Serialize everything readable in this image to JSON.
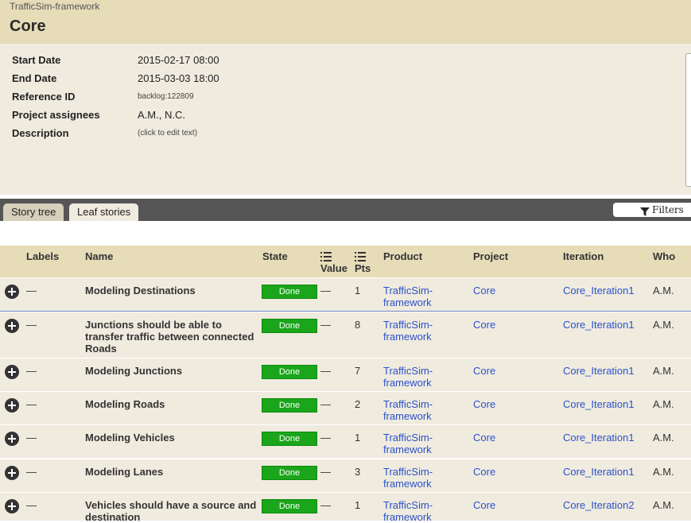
{
  "header": {
    "breadcrumb": "TrafficSim-framework",
    "title": "Core"
  },
  "info": {
    "start_date_label": "Start Date",
    "start_date": "2015-02-17 08:00",
    "end_date_label": "End Date",
    "end_date": "2015-03-03 18:00",
    "reference_label": "Reference ID",
    "reference": "backlog:122809",
    "assignees_label": "Project assignees",
    "assignees": "A.M., N.C.",
    "description_label": "Description",
    "description": "(click to edit text)"
  },
  "tabs": {
    "story_tree": "Story tree",
    "leaf_stories": "Leaf stories",
    "filters": "Filters"
  },
  "table": {
    "headers": {
      "labels": "Labels",
      "name": "Name",
      "state": "State",
      "value": "Value",
      "pts": "Pts",
      "product": "Product",
      "project": "Project",
      "iteration": "Iteration",
      "who": "Who"
    },
    "rows": [
      {
        "labels": "—",
        "name": "Modeling Destinations",
        "state": "Done",
        "value": "—",
        "pts": "1",
        "product": "TrafficSim-framework",
        "project": "Core",
        "iteration": "Core_Iteration1",
        "who": "A.M."
      },
      {
        "labels": "—",
        "name": "Junctions should be able to transfer traffic between connected Roads",
        "state": "Done",
        "value": "—",
        "pts": "8",
        "product": "TrafficSim-framework",
        "project": "Core",
        "iteration": "Core_Iteration1",
        "who": "A.M."
      },
      {
        "labels": "—",
        "name": "Modeling Junctions",
        "state": "Done",
        "value": "—",
        "pts": "7",
        "product": "TrafficSim-framework",
        "project": "Core",
        "iteration": "Core_Iteration1",
        "who": "A.M."
      },
      {
        "labels": "—",
        "name": "Modeling Roads",
        "state": "Done",
        "value": "—",
        "pts": "2",
        "product": "TrafficSim-framework",
        "project": "Core",
        "iteration": "Core_Iteration1",
        "who": "A.M."
      },
      {
        "labels": "—",
        "name": "Modeling Vehicles",
        "state": "Done",
        "value": "—",
        "pts": "1",
        "product": "TrafficSim-framework",
        "project": "Core",
        "iteration": "Core_Iteration1",
        "who": "A.M."
      },
      {
        "labels": "—",
        "name": "Modeling Lanes",
        "state": "Done",
        "value": "—",
        "pts": "3",
        "product": "TrafficSim-framework",
        "project": "Core",
        "iteration": "Core_Iteration1",
        "who": "A.M."
      },
      {
        "labels": "—",
        "name": "Vehicles should have a source and destination",
        "state": "Done",
        "value": "—",
        "pts": "1",
        "product": "TrafficSim-framework",
        "project": "Core",
        "iteration": "Core_Iteration2",
        "who": "A.M."
      }
    ]
  }
}
